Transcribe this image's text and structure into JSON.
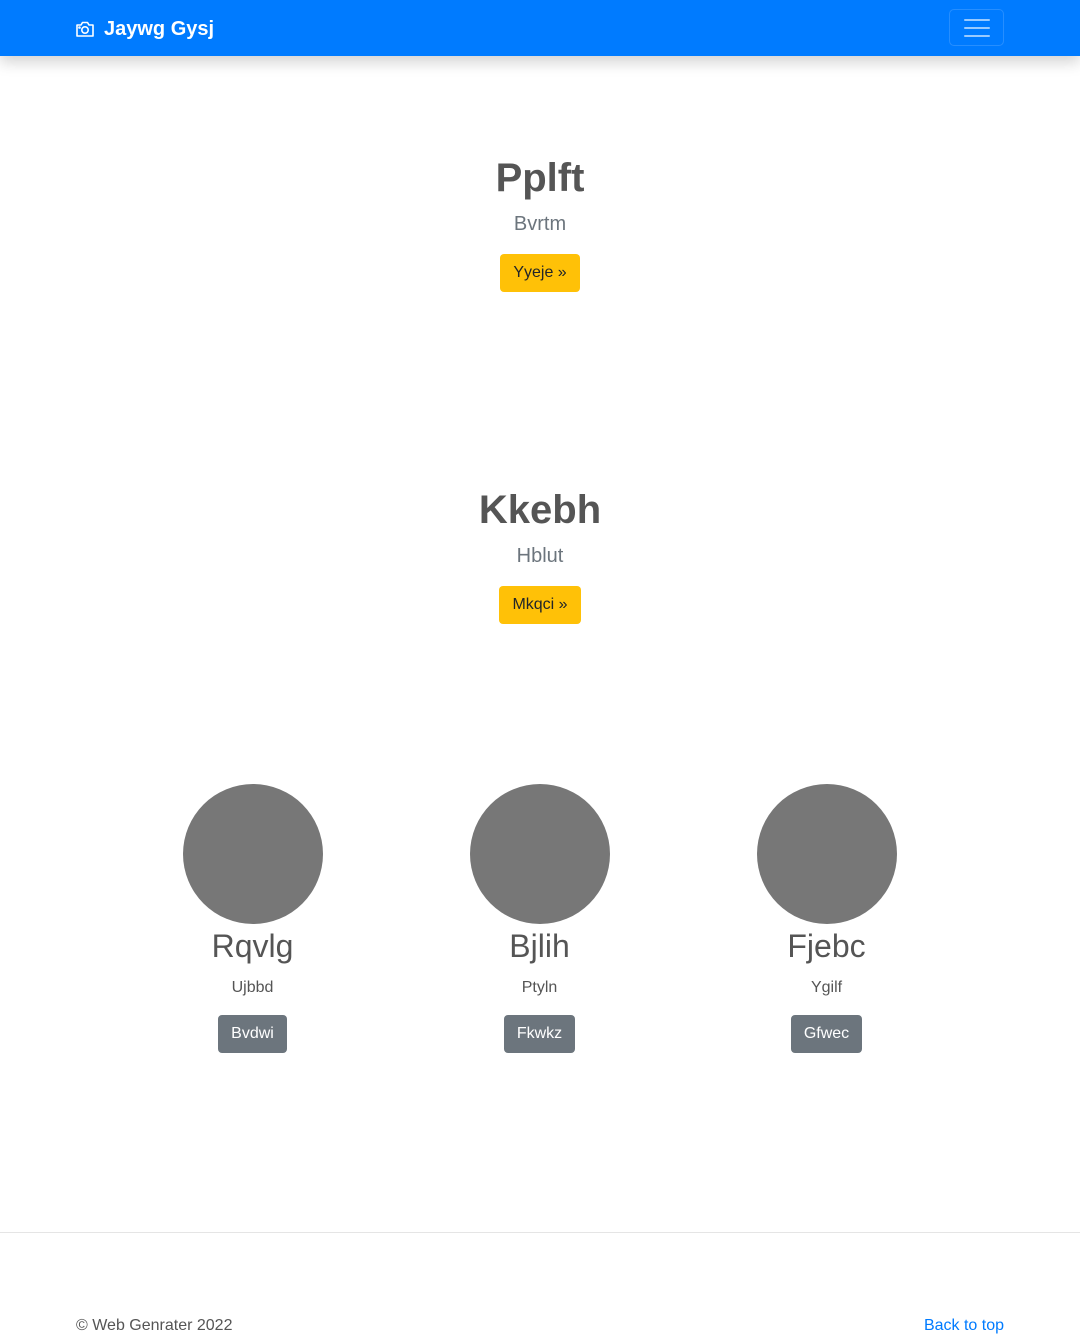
{
  "navbar": {
    "brand_icon": "camera-icon",
    "brand_name": "Jaywg Gysj",
    "toggler_icon": "hamburger-menu-icon",
    "background_color": "#007bff"
  },
  "heroes": [
    {
      "title": "Pplft",
      "subtitle": "Bvrtm",
      "button_label": "Yyeje »"
    },
    {
      "title": "Kkebh",
      "subtitle": "Hblut",
      "button_label": "Mkqci »"
    }
  ],
  "columns": [
    {
      "name": "Rqvlg",
      "text": "Ujbbd",
      "button_label": "Bvdwi"
    },
    {
      "name": "Bjlih",
      "text": "Ptyln",
      "button_label": "Fkwkz"
    },
    {
      "name": "Fjebc",
      "text": "Ygilf",
      "button_label": "Gfwec"
    }
  ],
  "footer": {
    "copyright": "© Web Genrater 2022",
    "back_to_top": "Back to top"
  },
  "colors": {
    "primary": "#007bff",
    "warning": "#ffc107",
    "secondary": "#6c757d",
    "avatar_placeholder": "#777777"
  }
}
